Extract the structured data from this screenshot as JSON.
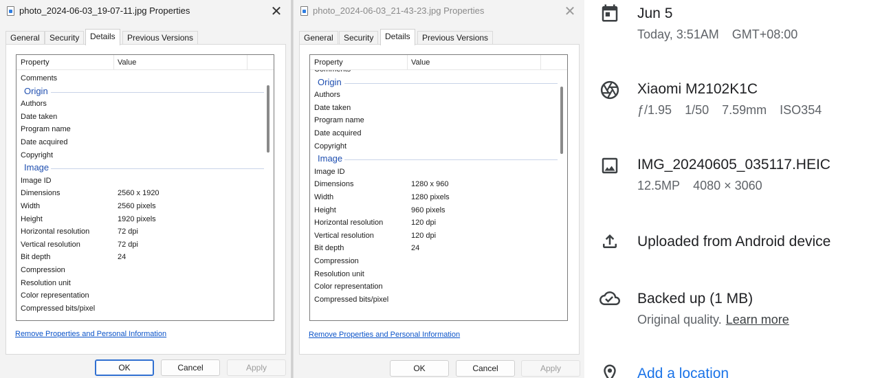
{
  "dialog1": {
    "title": "photo_2024-06-03_19-07-11.jpg Properties",
    "close_glyph": "✕",
    "tabs": [
      "General",
      "Security",
      "Details",
      "Previous Versions"
    ],
    "active_tab": "Details",
    "columns": {
      "property": "Property",
      "value": "Value"
    },
    "rows": [
      {
        "k": "Comments",
        "v": ""
      },
      {
        "group": "Origin"
      },
      {
        "k": "Authors",
        "v": ""
      },
      {
        "k": "Date taken",
        "v": ""
      },
      {
        "k": "Program name",
        "v": ""
      },
      {
        "k": "Date acquired",
        "v": ""
      },
      {
        "k": "Copyright",
        "v": ""
      },
      {
        "group": "Image"
      },
      {
        "k": "Image ID",
        "v": ""
      },
      {
        "k": "Dimensions",
        "v": "2560 x 1920"
      },
      {
        "k": "Width",
        "v": "2560 pixels"
      },
      {
        "k": "Height",
        "v": "1920 pixels"
      },
      {
        "k": "Horizontal resolution",
        "v": "72 dpi"
      },
      {
        "k": "Vertical resolution",
        "v": "72 dpi"
      },
      {
        "k": "Bit depth",
        "v": "24"
      },
      {
        "k": "Compression",
        "v": ""
      },
      {
        "k": "Resolution unit",
        "v": ""
      },
      {
        "k": "Color representation",
        "v": ""
      },
      {
        "k": "Compressed bits/pixel",
        "v": ""
      }
    ],
    "remove_link": "Remove Properties and Personal Information",
    "buttons": {
      "ok": "OK",
      "cancel": "Cancel",
      "apply": "Apply"
    }
  },
  "dialog2": {
    "title": "photo_2024-06-03_21-43-23.jpg Properties",
    "close_glyph": "✕",
    "tabs": [
      "General",
      "Security",
      "Details",
      "Previous Versions"
    ],
    "active_tab": "Details",
    "columns": {
      "property": "Property",
      "value": "Value"
    },
    "rows": [
      {
        "k": "Comments",
        "v": ""
      },
      {
        "group": "Origin"
      },
      {
        "k": "Authors",
        "v": ""
      },
      {
        "k": "Date taken",
        "v": ""
      },
      {
        "k": "Program name",
        "v": ""
      },
      {
        "k": "Date acquired",
        "v": ""
      },
      {
        "k": "Copyright",
        "v": ""
      },
      {
        "group": "Image"
      },
      {
        "k": "Image ID",
        "v": ""
      },
      {
        "k": "Dimensions",
        "v": "1280 x 960"
      },
      {
        "k": "Width",
        "v": "1280 pixels"
      },
      {
        "k": "Height",
        "v": "960 pixels"
      },
      {
        "k": "Horizontal resolution",
        "v": "120 dpi"
      },
      {
        "k": "Vertical resolution",
        "v": "120 dpi"
      },
      {
        "k": "Bit depth",
        "v": "24"
      },
      {
        "k": "Compression",
        "v": ""
      },
      {
        "k": "Resolution unit",
        "v": ""
      },
      {
        "k": "Color representation",
        "v": ""
      },
      {
        "k": "Compressed bits/pixel",
        "v": ""
      }
    ],
    "remove_link": "Remove Properties and Personal Information",
    "buttons": {
      "ok": "OK",
      "cancel": "Cancel",
      "apply": "Apply"
    }
  },
  "info": {
    "date": {
      "title": "Jun 5",
      "sub": [
        "Today, 3:51AM",
        "GMT+08:00"
      ],
      "icon": "calendar-icon"
    },
    "camera": {
      "title": "Xiaomi M2102K1C",
      "sub": [
        "ƒ/1.95",
        "1/50",
        "7.59mm",
        "ISO354"
      ],
      "icon": "aperture-icon"
    },
    "file": {
      "title": "IMG_20240605_035117.HEIC",
      "sub": [
        "12.5MP",
        "4080 × 3060"
      ],
      "icon": "image-icon"
    },
    "upload": {
      "title": "Uploaded from Android device",
      "icon": "upload-icon"
    },
    "backup": {
      "title": "Backed up (1 MB)",
      "sub_text": "Original quality.",
      "learn_more": "Learn more",
      "icon": "cloud-done-icon"
    },
    "location": {
      "title": "Add a location",
      "icon": "location-pin-icon"
    }
  },
  "colors": {
    "accent_link": "#0a53c9",
    "group_heading": "#1f4fb0",
    "google_blue": "#1a73e8"
  }
}
